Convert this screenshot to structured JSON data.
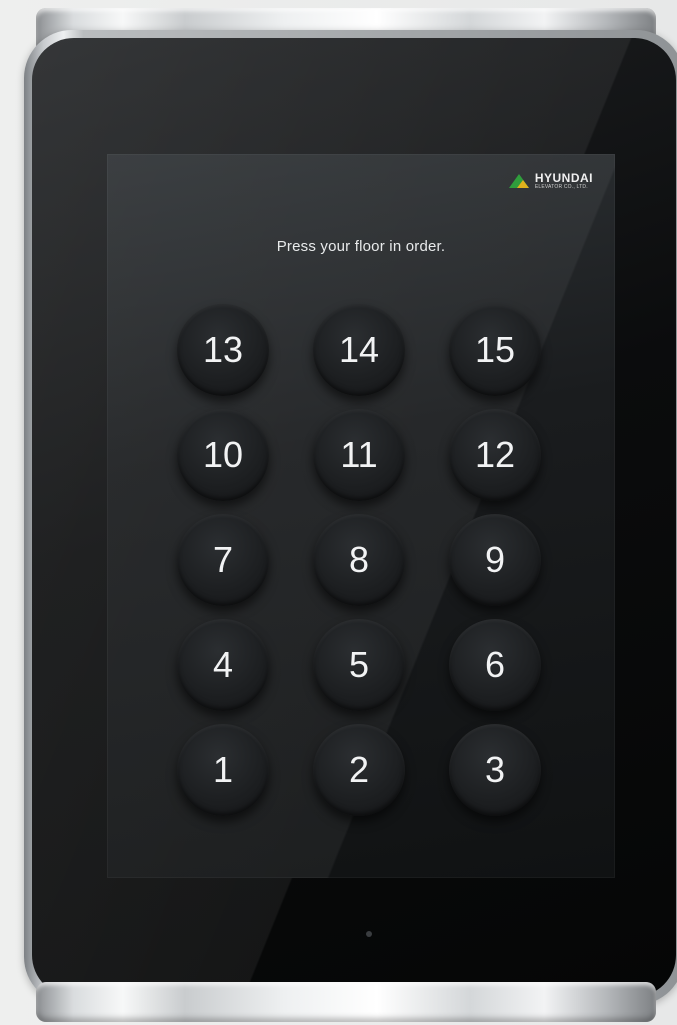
{
  "brand": {
    "name": "HYUNDAI",
    "subtitle": "ELEVATOR CO., LTD.",
    "colors": {
      "green": "#2f9e3c",
      "yellow": "#e0b21c"
    }
  },
  "screen": {
    "instruction": "Press your floor in order."
  },
  "keypad": {
    "keys": [
      "13",
      "14",
      "15",
      "10",
      "11",
      "12",
      "7",
      "8",
      "9",
      "4",
      "5",
      "6",
      "1",
      "2",
      "3"
    ]
  }
}
